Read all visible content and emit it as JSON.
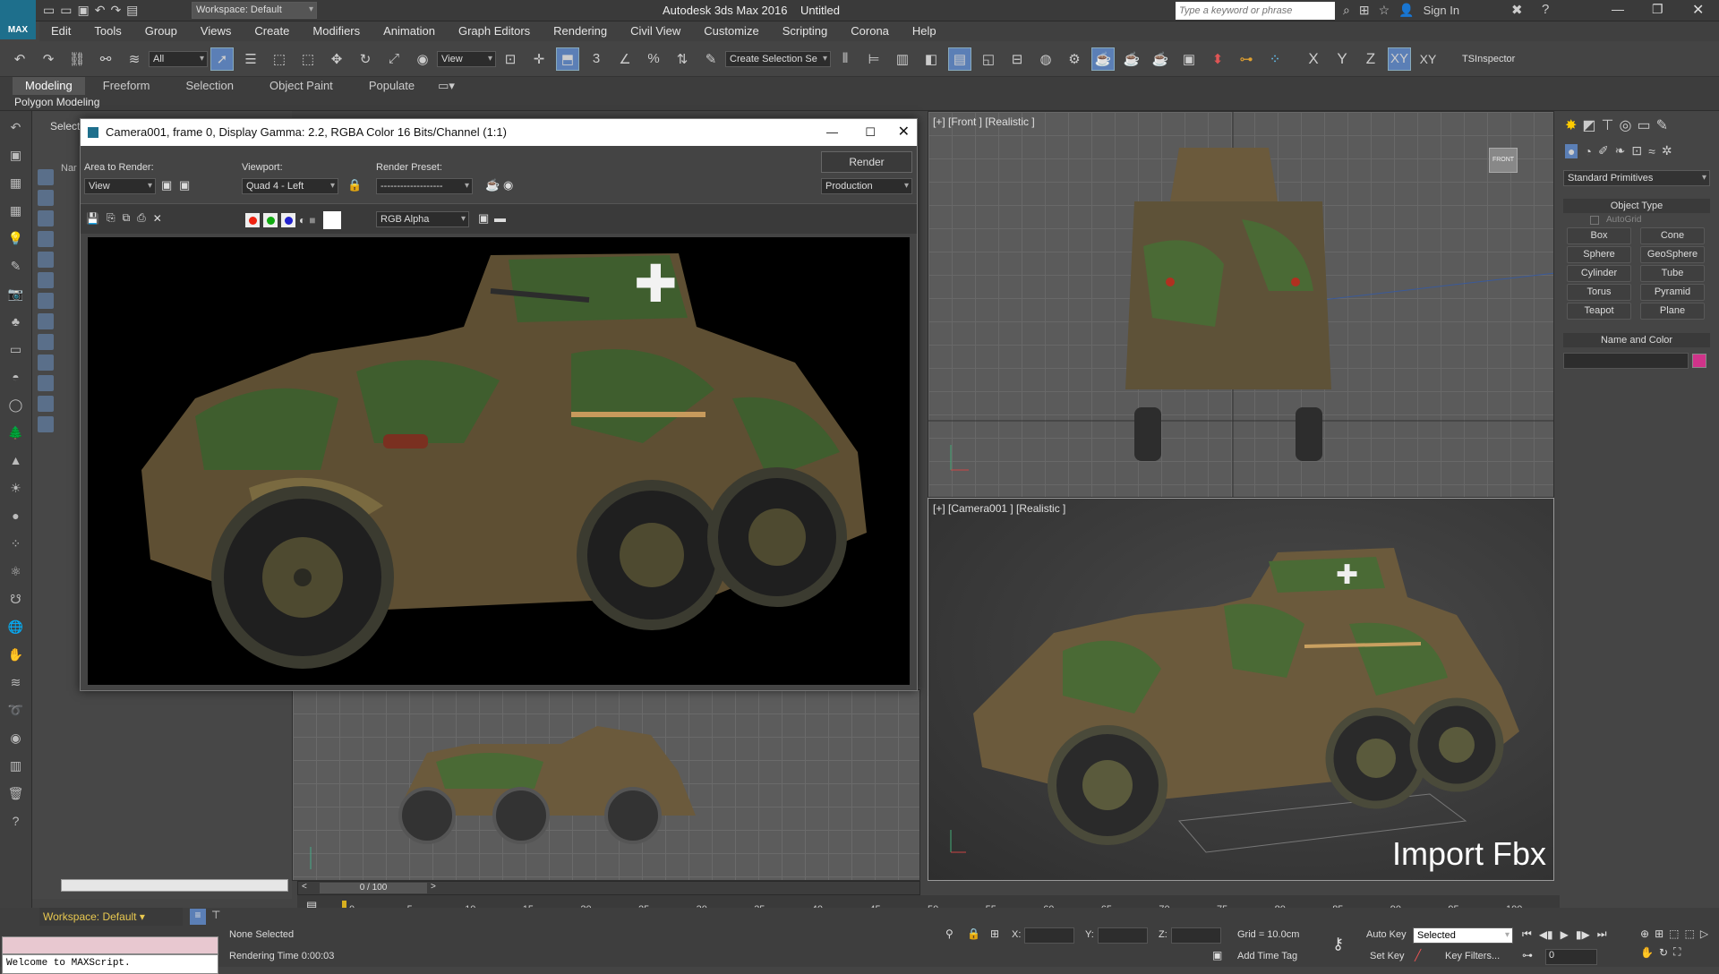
{
  "app": {
    "logo": "MAX",
    "workspace_label": "Workspace: Default",
    "title": "Autodesk 3ds Max 2016",
    "doc": "Untitled",
    "search_placeholder": "Type a keyword or phrase",
    "sign_in": "Sign In"
  },
  "menu": [
    "Edit",
    "Tools",
    "Group",
    "Views",
    "Create",
    "Modifiers",
    "Animation",
    "Graph Editors",
    "Rendering",
    "Civil View",
    "Customize",
    "Scripting",
    "Corona",
    "Help"
  ],
  "toolbar": {
    "filter": "All",
    "refcoord": "View",
    "selset_placeholder": "Create Selection Se",
    "axes": [
      "X",
      "Y",
      "Z",
      "XY",
      "XY"
    ],
    "tsinspector": "TSInspector"
  },
  "ribbon": {
    "tabs": [
      "Modeling",
      "Freeform",
      "Selection",
      "Object Paint",
      "Populate"
    ],
    "subtab": "Polygon Modeling"
  },
  "scene": {
    "select_label": "Select",
    "name_label": "Nar"
  },
  "framebuffer": {
    "title": "Camera001, frame 0, Display Gamma: 2.2, RGBA Color 16 Bits/Channel (1:1)",
    "area_label": "Area to Render:",
    "area_value": "View",
    "viewport_label": "Viewport:",
    "viewport_value": "Quad 4 - Left",
    "preset_label": "Render Preset:",
    "preset_value": "-------------------",
    "render_btn": "Render",
    "production": "Production",
    "channel": "RGB Alpha"
  },
  "viewports": {
    "front": "[+] [Front ] [Realistic ]",
    "camera": "[+] [Camera001 ] [Realistic ]",
    "overlay": "Import Fbx",
    "viewcube": "FRONT"
  },
  "command_panel": {
    "dropdown": "Standard Primitives",
    "object_type": "Object Type",
    "autogrid": "AutoGrid",
    "buttons": [
      "Box",
      "Cone",
      "Sphere",
      "GeoSphere",
      "Cylinder",
      "Tube",
      "Torus",
      "Pyramid",
      "Teapot",
      "Plane"
    ],
    "name_color": "Name and Color",
    "color": "#d0338a"
  },
  "timeline": {
    "frame": "0 / 100",
    "ticks": [
      "0",
      "5",
      "10",
      "15",
      "20",
      "25",
      "30",
      "35",
      "40",
      "45",
      "50",
      "55",
      "60",
      "65",
      "70",
      "75",
      "80",
      "85",
      "90",
      "95",
      "100"
    ]
  },
  "status": {
    "workspace": "Workspace: Default",
    "maxscript": "Welcome to MAXScript.",
    "selected": "None Selected",
    "render_time": "Rendering Time  0:00:03",
    "x": "X:",
    "y": "Y:",
    "z": "Z:",
    "grid": "Grid = 10.0cm",
    "add_time_tag": "Add Time Tag",
    "auto_key": "Auto Key",
    "set_key": "Set Key",
    "key_mode": "Selected",
    "key_filters": "Key Filters...",
    "frame_field": "0"
  }
}
